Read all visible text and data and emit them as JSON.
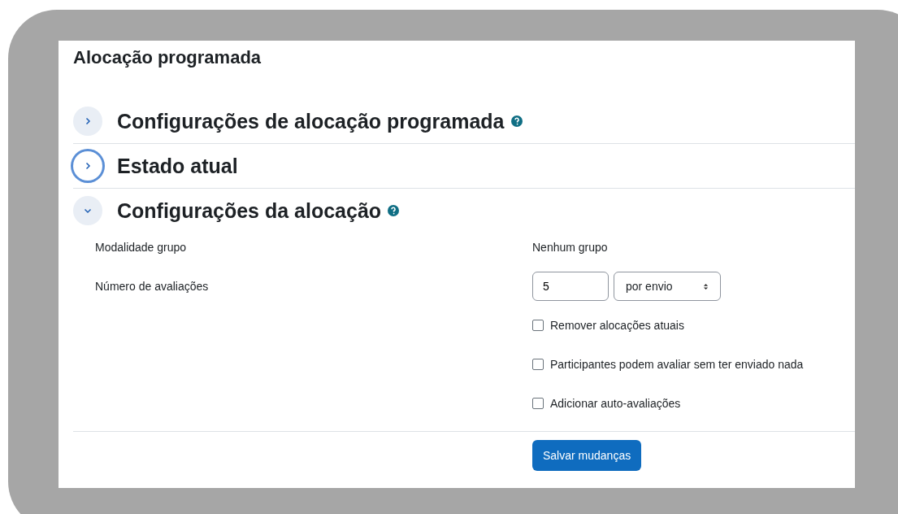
{
  "page_title": "Alocação programada",
  "sections": [
    {
      "title": "Configurações de alocação programada",
      "expanded": false,
      "focused": false,
      "help": true
    },
    {
      "title": "Estado atual",
      "expanded": false,
      "focused": true,
      "help": false
    },
    {
      "title": "Configurações da alocação",
      "expanded": true,
      "focused": false,
      "help": true
    }
  ],
  "fields": [
    {
      "kind": "static",
      "label": "Modalidade grupo",
      "value": "Nenhum grupo"
    },
    {
      "kind": "number_select",
      "label": "Número de avaliações",
      "value": "5",
      "select": "por envio"
    }
  ],
  "checkboxes": [
    {
      "label": "Remover alocações atuais",
      "checked": false
    },
    {
      "label": "Participantes podem avaliar sem ter enviado nada",
      "checked": false
    },
    {
      "label": "Adicionar auto-avaliações",
      "checked": false
    }
  ],
  "submit": "Salvar mudanças"
}
